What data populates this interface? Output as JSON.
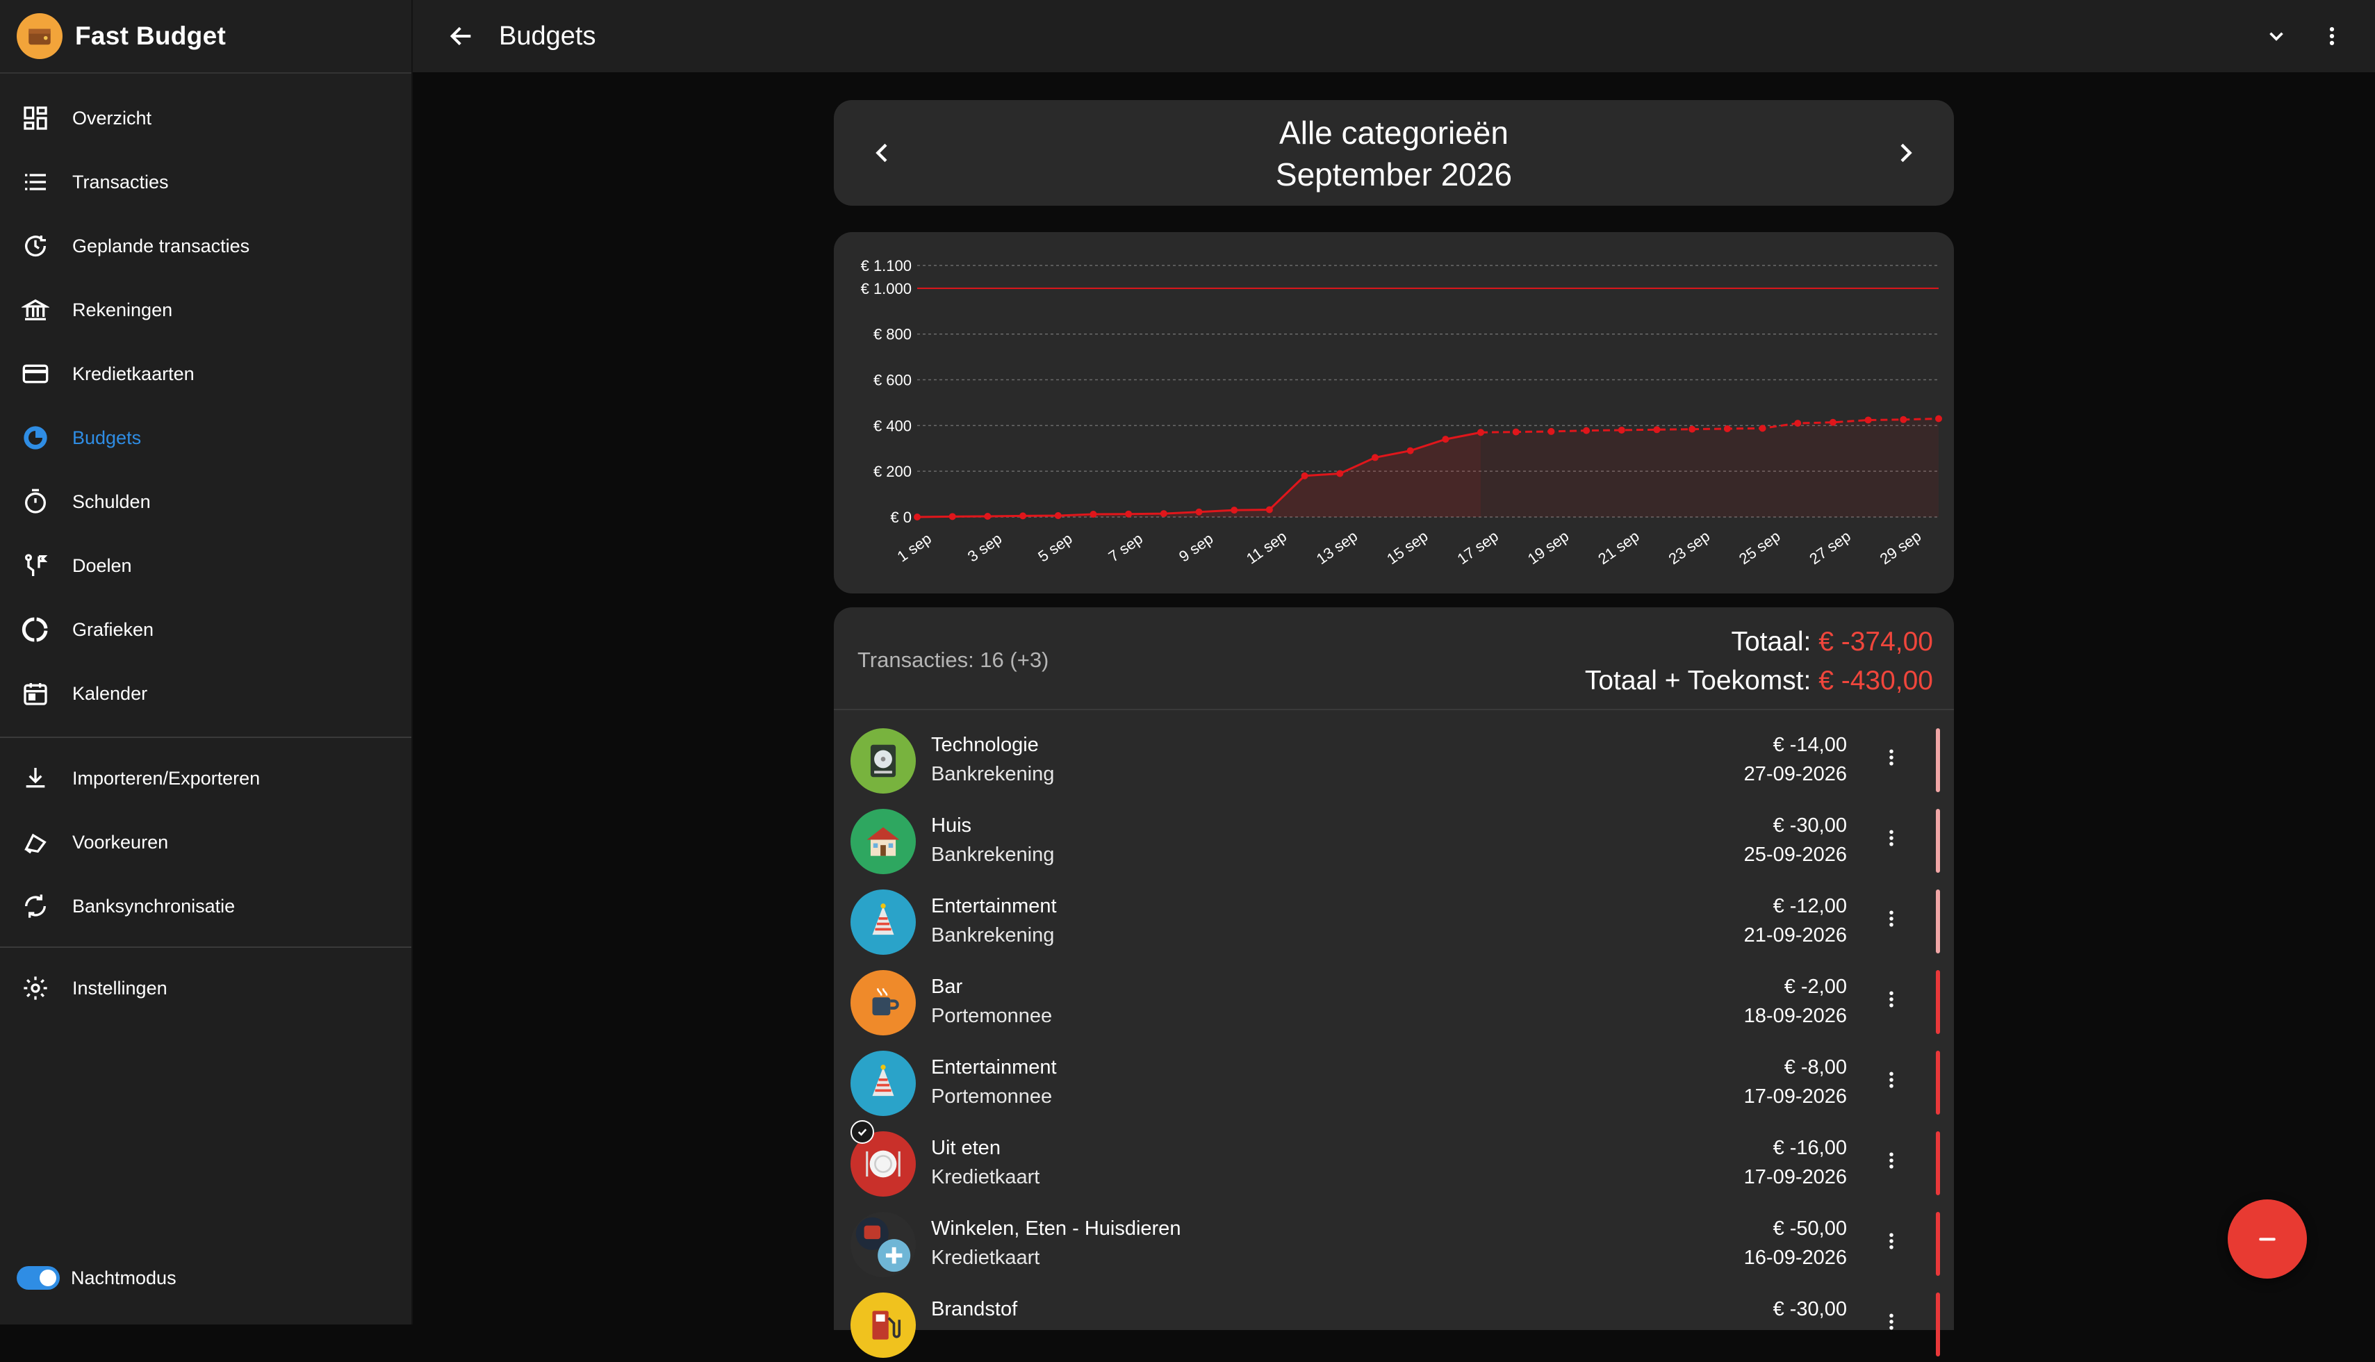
{
  "app": {
    "title": "Fast Budget"
  },
  "sidebar": {
    "items": [
      {
        "label": "Overzicht",
        "icon": "dashboard-icon"
      },
      {
        "label": "Transacties",
        "icon": "list-icon"
      },
      {
        "label": "Geplande transacties",
        "icon": "scheduled-icon"
      },
      {
        "label": "Rekeningen",
        "icon": "bank-icon"
      },
      {
        "label": "Kredietkaarten",
        "icon": "credit-card-icon"
      },
      {
        "label": "Budgets",
        "icon": "budget-pie-icon",
        "active": true
      },
      {
        "label": "Schulden",
        "icon": "timer-icon"
      },
      {
        "label": "Doelen",
        "icon": "goals-icon"
      },
      {
        "label": "Grafieken",
        "icon": "chart-ring-icon"
      },
      {
        "label": "Kalender",
        "icon": "calendar-icon"
      }
    ],
    "tools": [
      {
        "label": "Importeren/Exporteren",
        "icon": "download-icon"
      },
      {
        "label": "Voorkeuren",
        "icon": "preferences-icon"
      },
      {
        "label": "Banksynchronisatie",
        "icon": "sync-icon"
      }
    ],
    "settings": {
      "label": "Instellingen",
      "icon": "gear-icon"
    },
    "night_mode": {
      "label": "Nachtmodus",
      "enabled": true
    }
  },
  "topbar": {
    "title": "Budgets"
  },
  "period": {
    "category": "Alle categorieën",
    "month": "September 2026"
  },
  "chart_data": {
    "type": "line",
    "y_ticks": [
      "€ 0",
      "€ 200",
      "€ 400",
      "€ 600",
      "€ 800",
      "€ 1.000",
      "€ 1.100"
    ],
    "ylim": [
      0,
      1100
    ],
    "budget_limit": 1000,
    "x_tick_labels": [
      "1 sep",
      "3 sep",
      "5 sep",
      "7 sep",
      "9 sep",
      "11 sep",
      "13 sep",
      "15 sep",
      "17 sep",
      "19 sep",
      "21 sep",
      "23 sep",
      "25 sep",
      "27 sep",
      "29 sep"
    ],
    "series": [
      {
        "days": [
          1,
          2,
          3,
          4,
          5,
          6,
          7,
          8,
          9,
          10,
          11,
          12,
          13,
          14,
          15,
          16,
          17
        ],
        "values": [
          0,
          2,
          3,
          5,
          6,
          12,
          13,
          15,
          22,
          30,
          32,
          180,
          190,
          260,
          290,
          340,
          370
        ]
      },
      {
        "days": [
          17,
          18,
          19,
          20,
          21,
          22,
          23,
          24,
          25,
          26,
          27,
          28,
          29,
          30
        ],
        "values": [
          370,
          372,
          374,
          378,
          380,
          382,
          384,
          386,
          388,
          410,
          414,
          424,
          426,
          430
        ]
      }
    ],
    "colors": {
      "line": "#e0161b",
      "limit": "#e0161b",
      "grid": "#6b6b6b"
    }
  },
  "summary": {
    "count": "Transacties: 16 (+3)",
    "total_label": "Totaal: ",
    "total_value": "€ -374,00",
    "future_label": "Totaal + Toekomst: ",
    "future_value": "€ -430,00"
  },
  "transactions": [
    {
      "name": "Technologie",
      "account": "Bankrekening",
      "amount": "€ -14,00",
      "date": "27-09-2026",
      "icon": "technology-disk-icon",
      "bg": "#78b33e",
      "bar": "#f0a6a6"
    },
    {
      "name": "Huis",
      "account": "Bankrekening",
      "amount": "€ -30,00",
      "date": "25-09-2026",
      "icon": "house-icon",
      "bg": "#2ea760",
      "bar": "#f0a6a6"
    },
    {
      "name": "Entertainment",
      "account": "Bankrekening",
      "amount": "€ -12,00",
      "date": "21-09-2026",
      "icon": "party-hat-icon",
      "bg": "#2aa3c9",
      "bar": "#f0a6a6"
    },
    {
      "name": "Bar",
      "account": "Portemonnee",
      "amount": "€ -2,00",
      "date": "18-09-2026",
      "icon": "coffee-cup-icon",
      "bg": "#ef8a2a",
      "bar": "#e8383a"
    },
    {
      "name": "Entertainment",
      "account": "Portemonnee",
      "amount": "€ -8,00",
      "date": "17-09-2026",
      "icon": "party-hat-icon",
      "bg": "#2aa3c9",
      "bar": "#e8383a"
    },
    {
      "name": "Uit eten",
      "account": "Kredietkaart",
      "amount": "€ -16,00",
      "date": "17-09-2026",
      "icon": "dinner-plate-icon",
      "bg": "#c9302a",
      "bar": "#e8383a",
      "checked": true
    },
    {
      "name": "Winkelen, Eten - Huisdieren",
      "account": "Kredietkaart",
      "amount": "€ -50,00",
      "date": "16-09-2026",
      "icon": "multi-category-icon",
      "bg": "#2d2d2d",
      "bar": "#e8383a"
    },
    {
      "name": "Brandstof",
      "account": "",
      "amount": "€ -30,00",
      "date": "",
      "icon": "fuel-pump-icon",
      "bg": "#f0c21e",
      "bar": "#e8383a"
    }
  ],
  "fab": {
    "icon": "minus-icon",
    "color": "#e83a32"
  }
}
